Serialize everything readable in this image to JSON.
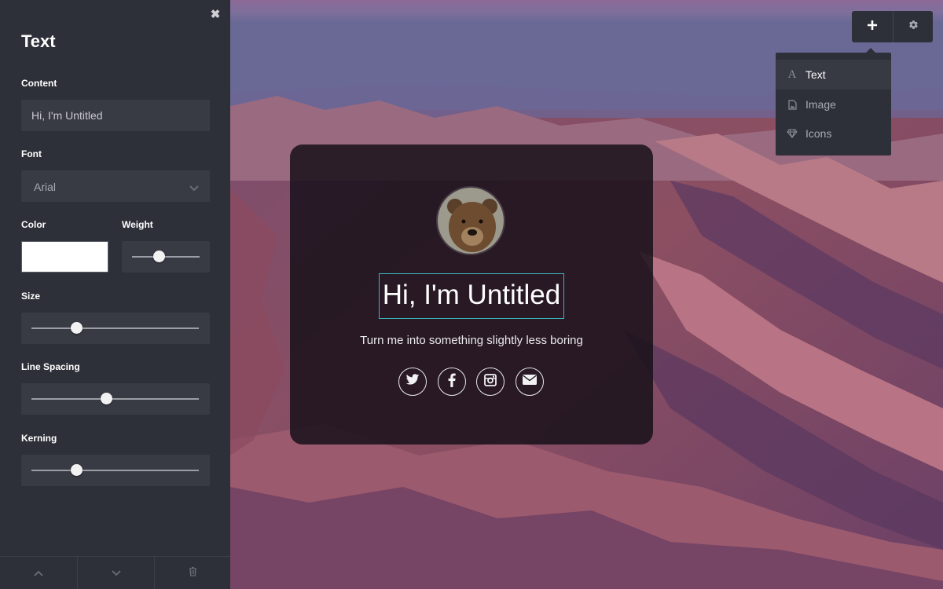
{
  "panel": {
    "title": "Text",
    "close_icon": "close-icon",
    "content_label": "Content",
    "content_value": "Hi, I'm Untitled",
    "font_label": "Font",
    "font_value": "Arial",
    "color_label": "Color",
    "color_value": "#ffffff",
    "weight_label": "Weight",
    "weight_level": 0.4,
    "size_label": "Size",
    "size_level": 0.27,
    "line_spacing_label": "Line Spacing",
    "line_spacing_level": 0.45,
    "kerning_label": "Kerning",
    "kerning_level": 0.27,
    "bottom_icons": [
      "chevron-up-icon",
      "chevron-down-icon",
      "trash-icon"
    ]
  },
  "card": {
    "headline": "Hi, I'm Untitled",
    "subline": "Turn me into something slightly less boring",
    "avatar_icon": "bear-avatar",
    "social_icons": [
      "twitter-icon",
      "facebook-icon",
      "instagram-icon",
      "envelope-icon"
    ]
  },
  "toolbar": {
    "add_icon": "plus-icon",
    "settings_icon": "gear-icon",
    "menu": [
      {
        "label": "Text",
        "icon": "text-icon",
        "active": true
      },
      {
        "label": "Image",
        "icon": "image-icon",
        "active": false
      },
      {
        "label": "Icons",
        "icon": "diamond-icon",
        "active": false
      }
    ]
  },
  "colors": {
    "sidebar_bg": "#2e3039",
    "field_bg": "#383a44",
    "accent_outline": "#3bb6be"
  }
}
